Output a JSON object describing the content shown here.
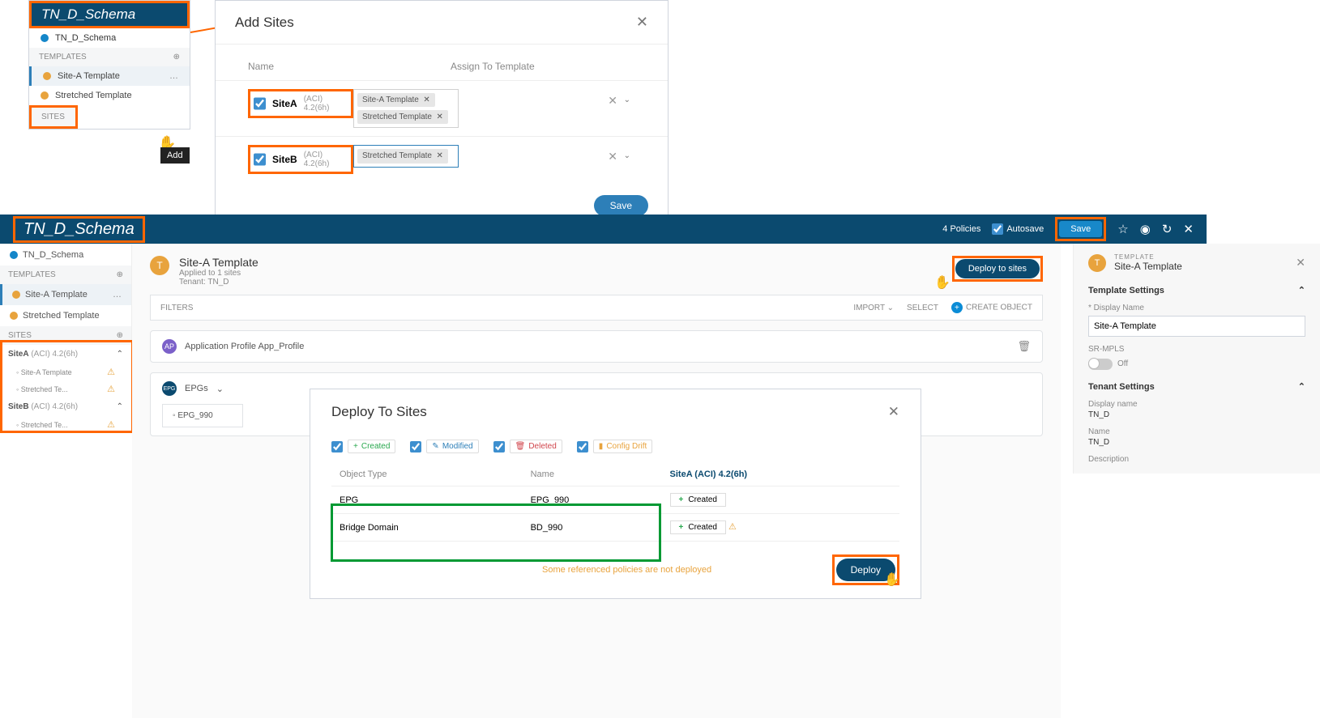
{
  "schema_name": "TN_D_Schema",
  "mini_sidebar": {
    "schema_row": "TN_D_Schema",
    "templates_hdr": "TEMPLATES",
    "tmpl_a": "Site-A Template",
    "tmpl_b": "Stretched Template",
    "sites_hdr": "SITES",
    "add_tip": "Add"
  },
  "add_sites": {
    "title": "Add Sites",
    "col_name": "Name",
    "col_assign": "Assign To Template",
    "siteA": {
      "name": "SiteA",
      "meta": "(ACI)  4.2(6h)",
      "chips": [
        "Site-A Template",
        "Stretched Template"
      ]
    },
    "siteB": {
      "name": "SiteB",
      "meta": "(ACI)  4.2(6h)",
      "chips": [
        "Stretched Template"
      ]
    },
    "save": "Save"
  },
  "top_bar": {
    "policies": "4 Policies",
    "autosave": "Autosave",
    "save": "Save"
  },
  "left_sidebar": {
    "schema": "TN_D_Schema",
    "templates_hdr": "TEMPLATES",
    "tmpl_a": "Site-A Template",
    "tmpl_b": "Stretched Template",
    "sites_hdr": "SITES",
    "siteA_hdr": "SiteA",
    "siteA_meta": "(ACI)  4.2(6h)",
    "siteA_sub1": "Site-A Template",
    "siteA_sub2": "Stretched Te...",
    "siteB_hdr": "SiteB",
    "siteB_meta": "(ACI)  4.2(6h)",
    "siteB_sub1": "Stretched Te..."
  },
  "canvas": {
    "tmpl_title": "Site-A Template",
    "applied": "Applied to 1 sites",
    "tenant": "Tenant: TN_D",
    "deploy_btn": "Deploy to sites",
    "filters": "FILTERS",
    "import": "IMPORT",
    "select": "SELECT",
    "create": "CREATE OBJECT",
    "app_profile": "Application Profile App_Profile",
    "epgs": "EPGs",
    "epg_card": "EPG_990"
  },
  "right": {
    "over": "TEMPLATE",
    "name": "Site-A Template",
    "sect_settings": "Template Settings",
    "lbl_dn": "* Display Name",
    "val_dn": "Site-A Template",
    "lbl_sr": "SR-MPLS",
    "off": "Off",
    "sect_tenant": "Tenant Settings",
    "lbl_tdn": "Display name",
    "val_tdn": "TN_D",
    "lbl_tn": "Name",
    "val_tn": "TN_D",
    "lbl_desc": "Description"
  },
  "deploy_modal": {
    "title": "Deploy To Sites",
    "legend_created": "Created",
    "legend_modified": "Modified",
    "legend_deleted": "Deleted",
    "legend_drift": "Config Drift",
    "th_type": "Object Type",
    "th_name": "Name",
    "th_site": "SiteA  (ACI)  4.2(6h)",
    "rows": [
      {
        "type": "EPG",
        "name": "EPG_990",
        "status": "Created",
        "warn": false
      },
      {
        "type": "Bridge Domain",
        "name": "BD_990",
        "status": "Created",
        "warn": true
      }
    ],
    "warn_line": "Some referenced policies are not deployed",
    "deploy": "Deploy"
  }
}
